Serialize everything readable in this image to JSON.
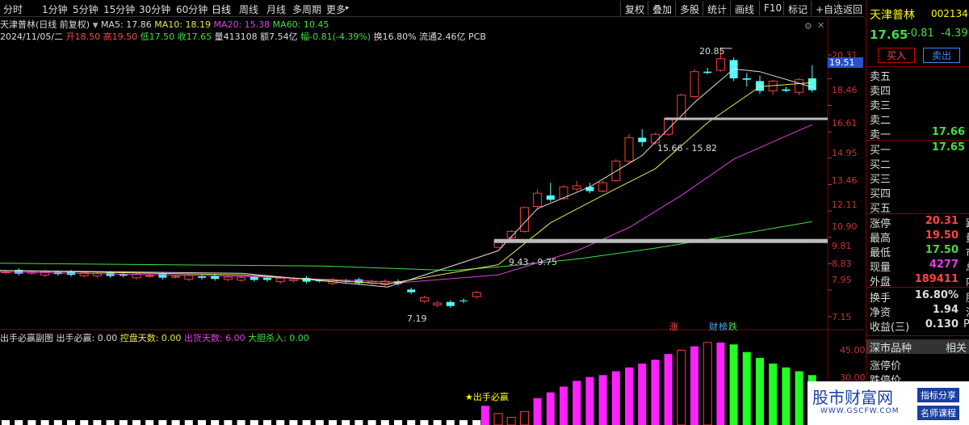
{
  "toolbar": {
    "periods": [
      "分时",
      "1分钟",
      "5分钟",
      "15分钟",
      "30分钟",
      "60分钟",
      "日线",
      "周线",
      "月线",
      "多周期",
      "更多"
    ],
    "more_caret": "▸",
    "right": [
      "复权",
      "叠加",
      "多股",
      "统计",
      "画线",
      "F10",
      "标记",
      "+自选",
      "返回"
    ]
  },
  "chart_info": {
    "title": "天津普林(日线 前复权)",
    "ma5": "MA5: 17.86",
    "ma10": "MA10: 18.19",
    "ma20": "MA20: 15.38",
    "ma60": "MA60: 10.45",
    "date": "2024/11/05/二",
    "open": "开18.50",
    "high": "高19.50",
    "low": "低17.50",
    "close": "收17.65",
    "vol": "量413108",
    "amt": "额7.54亿",
    "chg": "幅-0.81(-4.39%)",
    "turnover": "换16.80%",
    "float": "流通2.46亿",
    "pcb": "PCB"
  },
  "price_axis": [
    "20.31",
    "18.46",
    "16.61",
    "14.95",
    "13.46",
    "12.11",
    "10.90",
    "9.81",
    "8.83",
    "7.95",
    "7.15"
  ],
  "price_tag": "19.51",
  "annotations": {
    "high_label": "20.85",
    "low_label": "7.19",
    "zone1": "15.66 - 15.82",
    "zone2": "9.43 - 9.75",
    "tag1": "涨",
    "tag2": "财",
    "tag3": "榜",
    "tag4": "跌"
  },
  "sub_info": {
    "name": "出手必赢副图",
    "l1": "出手必赢: 0.00",
    "l2": "控盘天数: 0.00",
    "l3": "出货天数: 6.00",
    "l4": "大胆杀入: 0.00",
    "signal": "★出手必赢"
  },
  "sub_axis": [
    "45.00",
    "30.00"
  ],
  "panel": {
    "name": "天津普林",
    "code": "002134",
    "price": "17.65",
    "change": "-0.81",
    "pct": "-4.39",
    "buy_btn": "买入",
    "sell_btn": "卖出",
    "asks": [
      "卖五",
      "卖四",
      "卖三",
      "卖二",
      "卖一"
    ],
    "ask1_val": "17.66",
    "bids": [
      "买一",
      "买二",
      "买三",
      "买四",
      "买五"
    ],
    "bid1_val": "17.65",
    "stats": [
      {
        "label": "涨停",
        "value": "20.31",
        "ext": "跌"
      },
      {
        "label": "最高",
        "value": "19.50",
        "ext": "量"
      },
      {
        "label": "最低",
        "value": "17.50",
        "ext": "市"
      },
      {
        "label": "现量",
        "value": "4277",
        "ext": "总"
      },
      {
        "label": "外盘",
        "value": "189411",
        "ext": "内"
      }
    ],
    "stats2": [
      {
        "label": "换手",
        "value": "16.80%",
        "ext": "股"
      },
      {
        "label": "净资",
        "value": "1.94",
        "ext": "流"
      },
      {
        "label": "收益(三)",
        "value": "0.130",
        "ext": "PE"
      }
    ],
    "section": "深市品种",
    "section_ext": "相关",
    "extra1": "涨停价",
    "extra2": "跌停价"
  },
  "watermark": {
    "logo": "股市财富网",
    "site": "WWW.GSCFW.COM",
    "b1": "指标分享",
    "b2": "名师课程"
  },
  "chart_data": {
    "type": "candlestick",
    "ohlc_recent": [
      [
        9.43,
        9.75,
        9.43,
        9.7
      ],
      [
        9.8,
        10.1,
        9.75,
        10.05
      ],
      [
        10.05,
        11.1,
        10.0,
        11.05
      ],
      [
        11.1,
        11.9,
        10.95,
        11.7
      ],
      [
        11.6,
        12.2,
        11.3,
        11.4
      ],
      [
        11.45,
        12.1,
        11.4,
        12.0
      ],
      [
        11.9,
        12.3,
        11.8,
        12.05
      ],
      [
        12.0,
        12.2,
        11.7,
        11.8
      ],
      [
        11.8,
        12.3,
        11.75,
        12.2
      ],
      [
        12.3,
        13.4,
        12.25,
        13.3
      ],
      [
        13.3,
        14.8,
        13.2,
        14.6
      ],
      [
        14.6,
        15.1,
        14.1,
        14.35
      ],
      [
        14.3,
        14.9,
        14.2,
        14.8
      ],
      [
        14.8,
        15.85,
        14.7,
        15.7
      ],
      [
        15.7,
        17.4,
        15.66,
        17.3
      ],
      [
        17.2,
        19.2,
        17.1,
        19.0
      ],
      [
        19.0,
        19.3,
        18.8,
        18.9
      ],
      [
        19.1,
        20.85,
        19.0,
        20.0
      ],
      [
        19.9,
        20.1,
        18.3,
        18.5
      ],
      [
        18.5,
        18.9,
        17.9,
        18.4
      ],
      [
        18.3,
        18.7,
        17.4,
        17.6
      ],
      [
        17.6,
        18.4,
        17.3,
        18.3
      ],
      [
        17.7,
        17.9,
        17.5,
        17.6
      ],
      [
        17.5,
        18.5,
        17.3,
        18.4
      ],
      [
        18.5,
        19.5,
        17.5,
        17.65
      ]
    ],
    "sub_bars_recent": [
      6,
      4,
      7,
      14,
      17,
      20,
      23,
      25,
      26,
      28,
      30,
      32,
      34,
      37,
      39,
      41,
      43,
      43,
      42,
      38,
      35,
      32,
      30,
      28,
      26
    ],
    "sub_bars_color": [
      "m",
      "m",
      "m",
      "m",
      "m",
      "m",
      "m",
      "m",
      "m",
      "m",
      "m",
      "m",
      "m",
      "m",
      "h",
      "m",
      "h",
      "m",
      "g",
      "g",
      "g",
      "g",
      "g",
      "g",
      "g"
    ]
  }
}
